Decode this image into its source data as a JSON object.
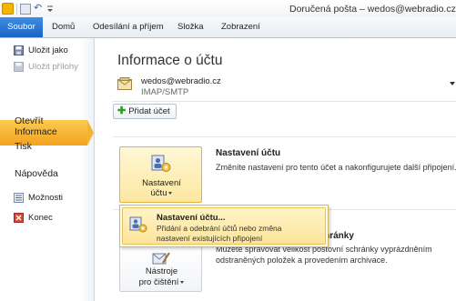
{
  "window": {
    "title": "Doručená pošta – wedos@webradio.cz"
  },
  "ribbon": {
    "tabs": [
      "Soubor",
      "Domů",
      "Odesílání a příjem",
      "Složka",
      "Zobrazení"
    ]
  },
  "backstage_nav": {
    "commands": [
      {
        "label": "Uložit jako",
        "icon": "save-as-icon",
        "enabled": true
      },
      {
        "label": "Uložit přílohy",
        "icon": "save-attachments-icon",
        "enabled": false
      }
    ],
    "active": "Informace",
    "items": [
      "Otevřít",
      "Tisk",
      "Nápověda"
    ],
    "bottom_commands": [
      {
        "label": "Možnosti",
        "icon": "options-icon"
      },
      {
        "label": "Konec",
        "icon": "exit-icon"
      }
    ]
  },
  "main": {
    "title": "Informace o účtu",
    "account": {
      "email": "wedos@webradio.cz",
      "type": "IMAP/SMTP"
    },
    "add_account_label": "Přidat účet",
    "account_settings": {
      "button_line1": "Nastavení",
      "button_line2": "účtu",
      "heading": "Nastavení účtu",
      "description": "Změníte nastavení pro tento účet a nakonfigurujete další připojení."
    },
    "cleanup": {
      "button_line1": "Nástroje",
      "button_line2": "pro čištění",
      "heading_partial": "schránky",
      "description_line1": "Můžete spravovat velikost poštovní schránky vyprázdněním",
      "description_line2": "odstraněných položek a provedením archivace."
    }
  },
  "dropdown": {
    "item_title": "Nastavení účtu...",
    "item_desc_line1": "Přidání a odebrání účtů nebo změna",
    "item_desc_line2": "nastavení existujících připojení"
  },
  "colors": {
    "file_tab": "#2a72d3",
    "active_nav": "#f6b233",
    "highlight": "#fde7a0"
  }
}
